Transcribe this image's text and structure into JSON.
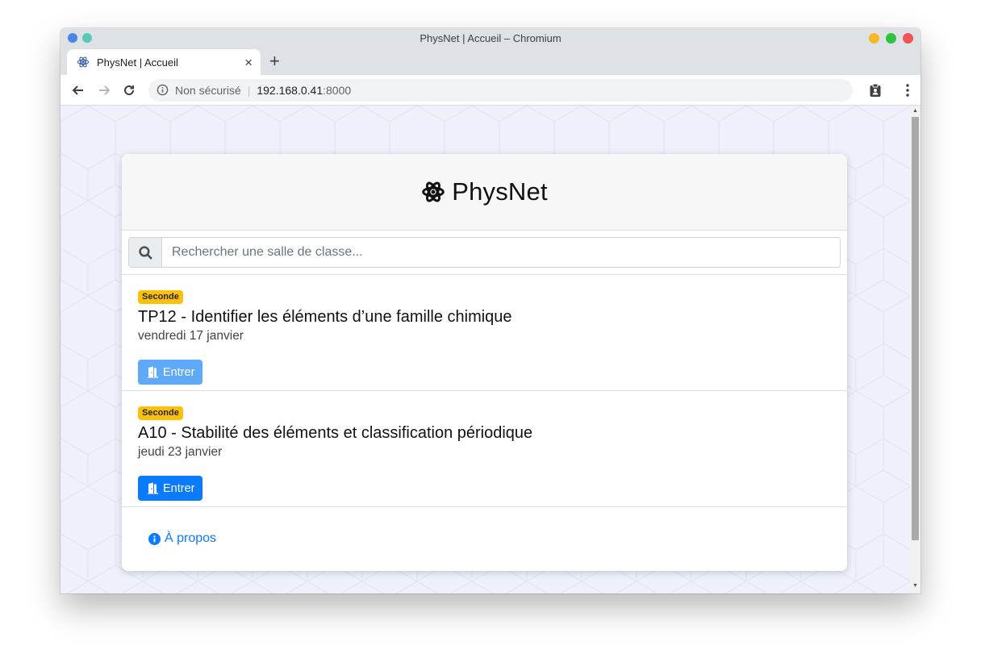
{
  "window": {
    "title": "PhysNet | Accueil – Chromium",
    "traffic_colors": [
      "#f5b926",
      "#2fc240",
      "#f05454"
    ]
  },
  "tab": {
    "label": "PhysNet | Accueil",
    "close_glyph": "×",
    "icon": "atom-icon"
  },
  "toolbar": {
    "new_tab_glyph": "+",
    "insecure_label": "Non sécurisé",
    "separator": "|",
    "url_host": "192.168.0.41",
    "url_port": ":8000"
  },
  "page": {
    "brand": "PhysNet",
    "brand_icon": "atom-icon",
    "search_placeholder": "Rechercher une salle de classe...",
    "rooms": [
      {
        "badge": "Seconde",
        "title": "TP12 - Identifier les éléments d’une famille chimique",
        "date": "vendredi 17 janvier",
        "button": "Entrer",
        "button_state": "disabled"
      },
      {
        "badge": "Seconde",
        "title": "A10 - Stabilité des éléments et classification périodique",
        "date": "jeudi 23 janvier",
        "button": "Entrer",
        "button_state": "active"
      }
    ],
    "about_link": "À propos"
  },
  "colors": {
    "primary": "#0a7bfd",
    "primary_disabled": "#5fa9f9",
    "badge": "#ffc107"
  }
}
